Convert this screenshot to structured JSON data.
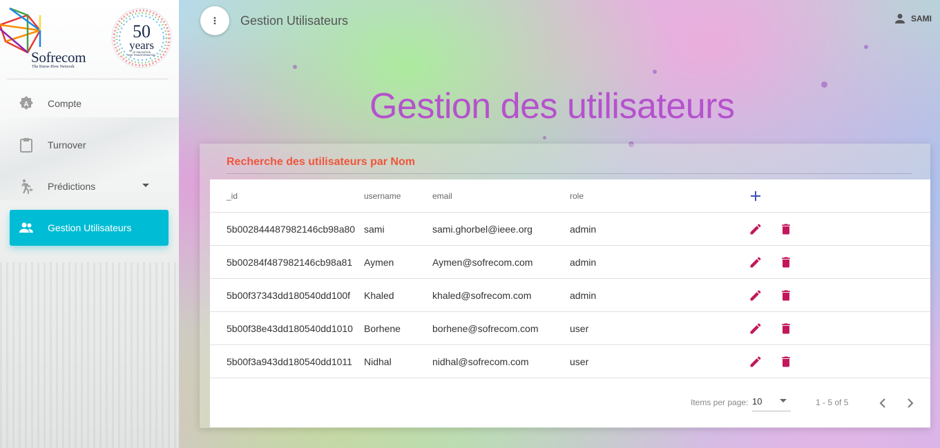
{
  "brand": {
    "name": "Sofrecom",
    "tagline": "The Know-How Network",
    "anniversary_number": "50",
    "anniversary_word": "years",
    "anniversary_sub1": "OF INNOVATION",
    "anniversary_sub2": "AND TRANSFORMATION"
  },
  "sidebar": {
    "items": [
      {
        "label": "Compte",
        "icon": "account-badge-icon",
        "active": false
      },
      {
        "label": "Turnover",
        "icon": "clipboard-icon",
        "active": false
      },
      {
        "label": "Prédictions",
        "icon": "walking-person-icon",
        "active": false,
        "has_dropdown": true
      },
      {
        "label": "Gestion Utilisateurs",
        "icon": "group-icon",
        "active": true
      }
    ]
  },
  "topbar": {
    "title": "Gestion Utilisateurs",
    "user_name": "SAMI"
  },
  "page": {
    "heading": "Gestion des utilisateurs",
    "search_label": "Recherche des utilisateurs par Nom"
  },
  "table": {
    "columns": [
      "_id",
      "username",
      "email",
      "role"
    ],
    "rows": [
      {
        "_id": "5b002844487982146cb98a80",
        "username": "sami",
        "email": "sami.ghorbel@ieee.org",
        "role": "admin"
      },
      {
        "_id": "5b00284f487982146cb98a81",
        "username": "Aymen",
        "email": "Aymen@sofrecom.com",
        "role": "admin"
      },
      {
        "_id": "5b00f37343dd180540dd100f",
        "username": "Khaled",
        "email": "khaled@sofrecom.com",
        "role": "admin"
      },
      {
        "_id": "5b00f38e43dd180540dd1010",
        "username": "Borhene",
        "email": "borhene@sofrecom.com",
        "role": "user"
      },
      {
        "_id": "5b00f3a943dd180540dd1011",
        "username": "Nidhal",
        "email": "nidhal@sofrecom.com",
        "role": "user"
      }
    ]
  },
  "paginator": {
    "items_per_page_label": "Items per page:",
    "page_size": "10",
    "range_label": "1 - 5 of 5"
  },
  "colors": {
    "active_nav": "#00bcd4",
    "heading": "#b552cd",
    "search_label": "#f0553c",
    "action_icons": "#c2185b",
    "add_icon": "#3f51b5"
  }
}
